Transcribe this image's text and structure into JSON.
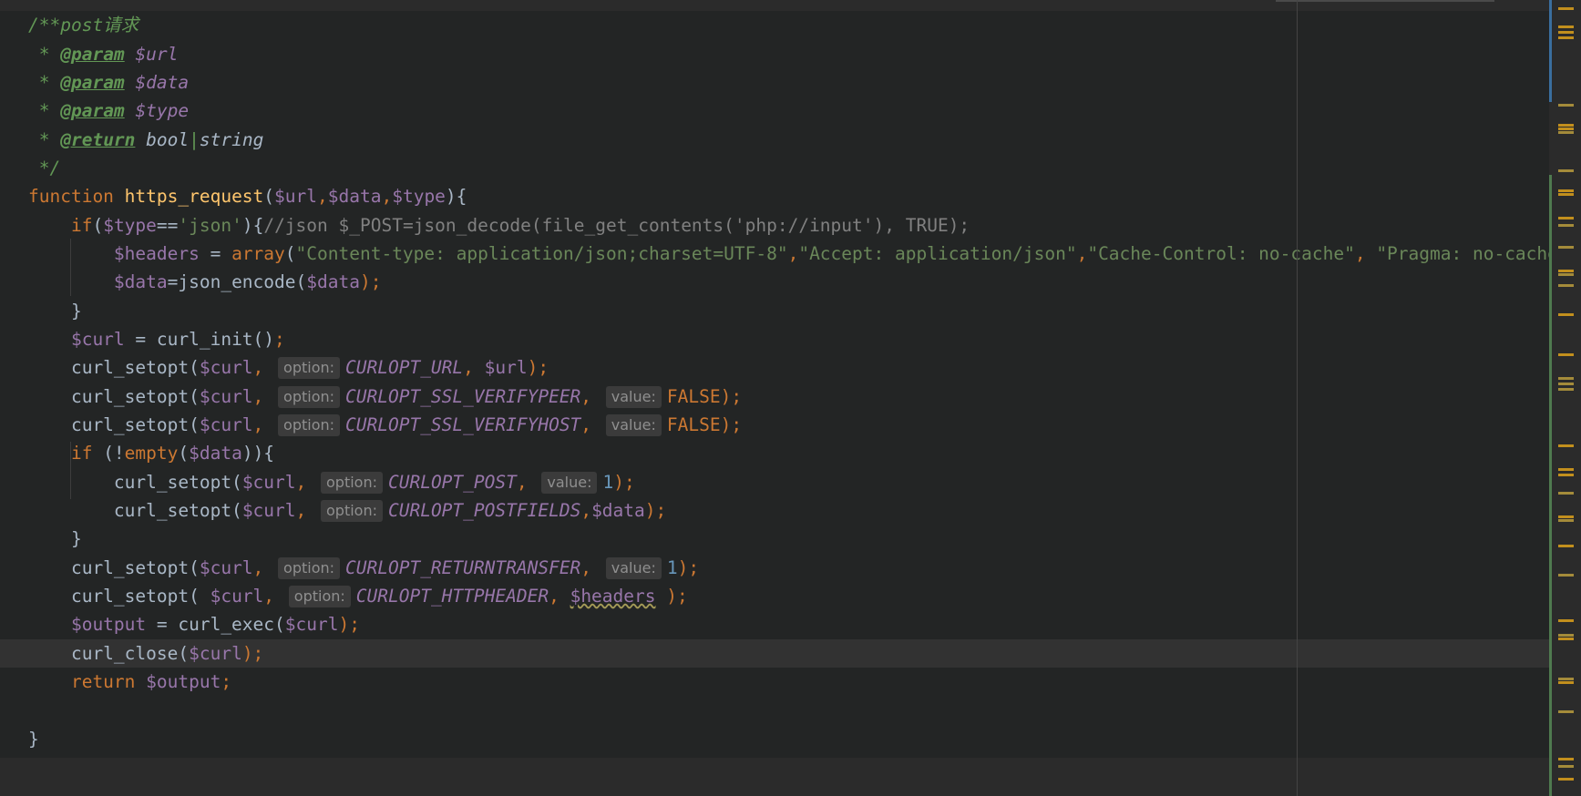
{
  "editor": {
    "language": "PHP",
    "colors": {
      "background": "#232525",
      "comment": "#629755",
      "keyword": "#cc7832",
      "function": "#ffc66d",
      "variable": "#9876aa",
      "string": "#6a8759",
      "number": "#6897bb",
      "hint_background": "#3b3b3b"
    },
    "tokens": {
      "doc_open": "/**post请求",
      "star": " * ",
      "param_tag": "@param",
      "return_tag": "@return",
      "p_url": "$url",
      "p_data": "$data",
      "p_type": "$type",
      "ret_bool": "bool",
      "ret_pipe": "|",
      "ret_string": "string",
      "doc_close": " */",
      "l7_kw": "function ",
      "l7_name": "https_request",
      "l7_open": "(",
      "l7_v1": "$url",
      "l7_c1": ",",
      "l7_v2": "$data",
      "l7_c2": ",",
      "l7_v3": "$type",
      "l7_close": "){",
      "l8_if": "    if",
      "l8_open": "(",
      "l8_var": "$type",
      "l8_eq": "==",
      "l8_str": "'json'",
      "l8_close": "){",
      "l8_comment": "//json $_POST=json_decode(file_get_contents('php://input'), TRUE);",
      "l9_var": "        $headers",
      "l9_eq": " = ",
      "l9_fn": "array",
      "l9_open": "(",
      "l9_s1": "\"Content-type: application/json;charset=UTF-8\"",
      "l9_c1": ",",
      "l9_s2": "\"Accept: application/json\"",
      "l9_c2": ",",
      "l9_s3": "\"Cache-Control: no-cache\"",
      "l9_c3": ", ",
      "l9_s4": "\"Pragma: no-cache\"",
      "l10_var": "        $data",
      "l10_eq": "=json_encode(",
      "l10_arg": "$data",
      "l10_end": ");",
      "l11": "    }",
      "l12_var": "    $curl",
      "l12_mid": " = curl_init()",
      "l12_end": ";",
      "setopt_indent": "    curl_setopt(",
      "setopt_indent2": "        curl_setopt(",
      "curl_var": "$curl",
      "comma": ", ",
      "option_hint": "option:",
      "value_hint": "value:",
      "l13_const": "CURLOPT_URL",
      "l13_var": "$url",
      "paren_semi": ");",
      "l14_const": "CURLOPT_SSL_VERIFYPEER",
      "false": "FALSE",
      "l15_const": "CURLOPT_SSL_VERIFYHOST",
      "l16_if": "    if ",
      "l16_mid": "(!",
      "l16_fn": "empty",
      "l16_open": "(",
      "l16_var": "$data",
      "l16_end": ")){",
      "l17_const": "CURLOPT_POST",
      "one": "1",
      "l18_const": "CURLOPT_POSTFIELDS",
      "l18_comma": ",",
      "l18_var": "$data",
      "l19": "    }",
      "l20_const": "CURLOPT_RETURNTRANSFER",
      "l21_open": "    curl_setopt( ",
      "l21_const": "CURLOPT_HTTPHEADER",
      "l21_var": "$headers",
      "l21_end": " );",
      "l22_var": "    $output",
      "l22_mid": " = curl_exec(",
      "l22_arg": "$curl",
      "l23_fn": "    curl_close(",
      "l23_arg": "$curl",
      "l24_kw": "    return ",
      "l24_var": "$output",
      "l24_end": ";",
      "l26": "}"
    }
  }
}
